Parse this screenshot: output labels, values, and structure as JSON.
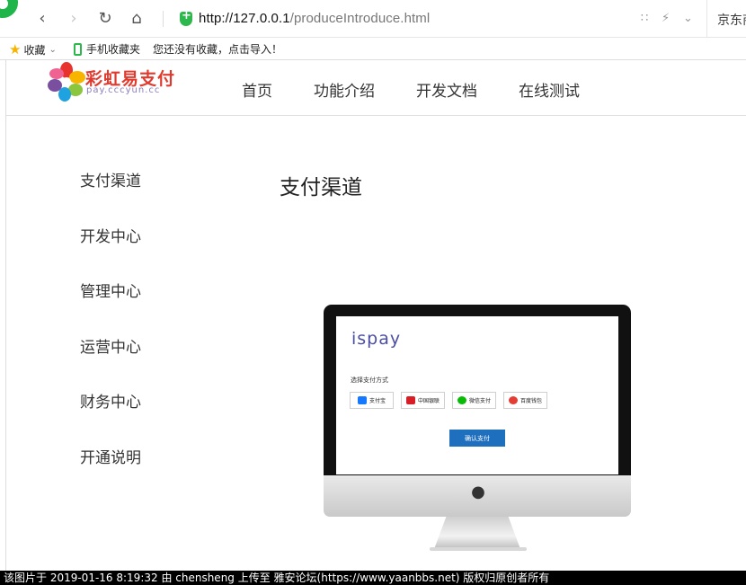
{
  "browser": {
    "url": "http://127.0.0.1/produceIntroduce.html",
    "url_host": "http://127.0.0.1",
    "url_path": "/produceIntroduce.html",
    "tab_partial": "京东商"
  },
  "bookmarks": {
    "favorites_label": "收藏",
    "mobile_label": "手机收藏夹",
    "import_hint": "您还没有收藏，点击导入！"
  },
  "site": {
    "logo_cn": "彩虹易支付",
    "logo_en": "pay.cccyun.cc",
    "nav": [
      "首页",
      "功能介绍",
      "开发文档",
      "在线测试"
    ]
  },
  "sidebar": {
    "items": [
      "支付渠道",
      "开发中心",
      "管理中心",
      "运营中心",
      "财务中心",
      "开通说明"
    ]
  },
  "content": {
    "title": "支付渠道"
  },
  "mockup": {
    "brand": "ispay",
    "choose_label": "选择支付方式",
    "methods": [
      {
        "label": "支付宝",
        "color": "#1677ff"
      },
      {
        "label": "中国银联",
        "color": "#d71e27"
      },
      {
        "label": "微信支付",
        "color": "#09bb07"
      },
      {
        "label": "百度钱包",
        "color": "#e33e33"
      }
    ],
    "confirm_label": "确认支付"
  },
  "watermark": "该图片于 2019-01-16 8:19:32 由 chensheng 上传至 雅安论坛(https://www.yaanbbs.net) 版权归原创者所有"
}
